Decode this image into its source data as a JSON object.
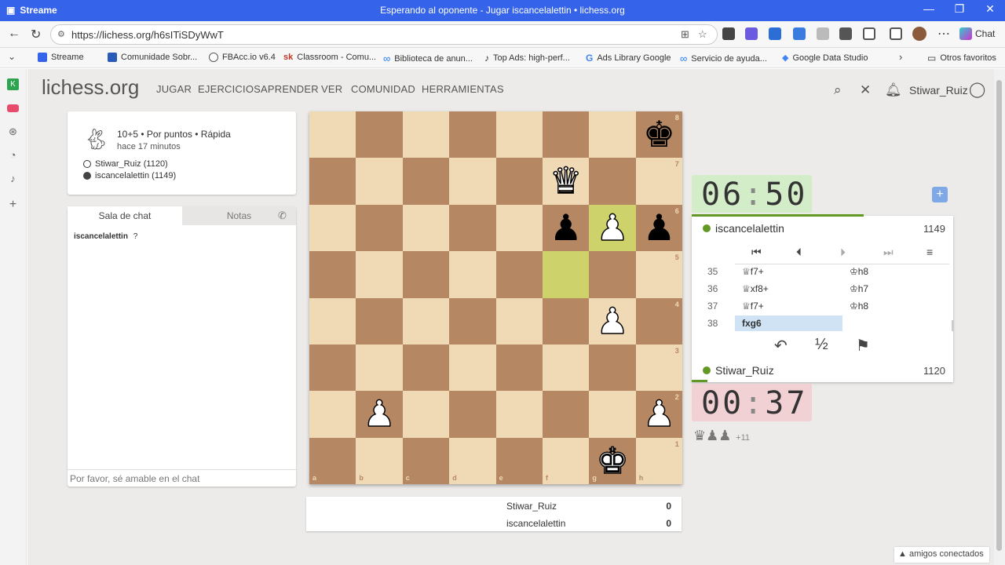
{
  "window": {
    "app_name": "Streame",
    "title": "Esperando al oponente - Jugar iscancelalettin • lichess.org"
  },
  "browser": {
    "url": "https://lichess.org/h6sITiSDyWwT",
    "chat_label": "Chat",
    "bookmarks": [
      "Streame",
      "Comunidade Sobr...",
      "FBAcc.io v6.4",
      "Classroom - Comu...",
      "Biblioteca de anun...",
      "Top Ads: high-perf...",
      "Ads Library Google",
      "Servicio de ayuda...",
      "Google Data Studio"
    ],
    "bookmarks_folder": "Otros favoritos"
  },
  "site": {
    "logo_main": "lichess",
    "logo_tld": ".org",
    "nav": [
      "JUGAR",
      "EJERCICIOS",
      "APRENDER",
      "VER",
      "COMUNIDAD",
      "HERRAMIENTAS"
    ],
    "username": "Stiwar_Ruiz"
  },
  "game_info": {
    "mode": "10+5 • Por puntos • Rápida",
    "ago": "hace 17 minutos",
    "white_player": "Stiwar_Ruiz (1120)",
    "black_player": "iscancelalettin (1149)"
  },
  "chat": {
    "tab_chat": "Sala de chat",
    "tab_notes": "Notas",
    "message_user": "iscancelalettin",
    "message_text": "?",
    "input_placeholder": "Por favor, sé amable en el chat"
  },
  "board": {
    "files": [
      "a",
      "b",
      "c",
      "d",
      "e",
      "f",
      "g",
      "h"
    ],
    "ranks": [
      "8",
      "7",
      "6",
      "5",
      "4",
      "3",
      "2",
      "1"
    ],
    "highlighted_squares": [
      "f5",
      "g6"
    ],
    "pieces": [
      {
        "square": "h8",
        "glyph": "♚",
        "color": "b"
      },
      {
        "square": "f7",
        "glyph": "♛",
        "color": "w"
      },
      {
        "square": "f6",
        "glyph": "♟",
        "color": "b"
      },
      {
        "square": "g6",
        "glyph": "♟",
        "color": "w"
      },
      {
        "square": "h6",
        "glyph": "♟",
        "color": "b"
      },
      {
        "square": "g4",
        "glyph": "♟",
        "color": "w"
      },
      {
        "square": "b2",
        "glyph": "♟",
        "color": "w"
      },
      {
        "square": "h2",
        "glyph": "♟",
        "color": "w"
      },
      {
        "square": "g1",
        "glyph": "♚",
        "color": "w"
      }
    ]
  },
  "crosstable": {
    "rows": [
      {
        "name": "Stiwar_Ruiz",
        "score": "0"
      },
      {
        "name": "iscancelalettin",
        "score": "0"
      }
    ]
  },
  "clocks": {
    "top": {
      "min": "06",
      "sec": "50"
    },
    "bottom": {
      "min": "00",
      "sec": "37"
    }
  },
  "players": {
    "top": {
      "name": "iscancelalettin",
      "rating": "1149"
    },
    "bottom": {
      "name": "Stiwar_Ruiz",
      "rating": "1120"
    }
  },
  "moves": [
    {
      "n": "35",
      "white": "♕f7+",
      "black": "♔h8"
    },
    {
      "n": "36",
      "white": "♕xf8+",
      "black": "♔h7"
    },
    {
      "n": "37",
      "white": "♕f7+",
      "black": "♔h8"
    },
    {
      "n": "38",
      "white": "fxg6",
      "black": ""
    }
  ],
  "actions": {
    "takeback": "↶",
    "draw": "½",
    "resign": "⚑"
  },
  "material": {
    "glyphs": "♛♟♟",
    "diff": "+11"
  },
  "friends_label": "amigos conectados",
  "colors": {
    "titlebar": "#3563e9",
    "board_light": "#f0d9b5",
    "board_dark": "#b58863",
    "highlight": "#cdd26a",
    "clock_active": "#d4edc9",
    "clock_low": "#f2d1d4",
    "online": "#629924"
  }
}
